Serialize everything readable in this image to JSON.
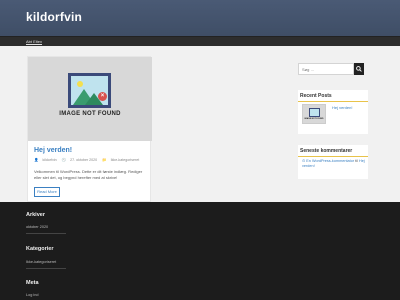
{
  "header": {
    "site_title": "kildorfvin"
  },
  "nav": {
    "items": [
      "Abt Eltex"
    ]
  },
  "post": {
    "thumbnail_text": "IMAGE NOT FOUND",
    "title": "Hej verden!",
    "author": "kildorfvin",
    "date": "27. oktober 2020",
    "category": "Ikke-kategoriseret",
    "excerpt": "Velkommen til WordPress. Dette er dit første indlæg. Rediger eller slet det, og begynd herefter med at skrive!",
    "read_more": "Read More"
  },
  "sidebar": {
    "search": {
      "placeholder": "Søg …",
      "button_icon": "search-icon"
    },
    "recent_posts": {
      "title": "Recent Posts",
      "items": [
        {
          "title": "Hej verden!",
          "thumbnail_text": "IMAGE NOT FOUND"
        }
      ]
    },
    "recent_comments": {
      "title": "Seneste kommentarer",
      "items": [
        {
          "author": "En WordPress-kommentator",
          "connector": "til",
          "post": "Hej verden!"
        }
      ]
    }
  },
  "footer": {
    "archives": {
      "title": "Arkiver",
      "items": [
        "oktober 2020"
      ]
    },
    "categories": {
      "title": "Kategorier",
      "items": [
        "Ikke-kategoriseret"
      ]
    },
    "meta": {
      "title": "Meta",
      "items": [
        "Log ind"
      ]
    }
  },
  "colors": {
    "header_bg": "#44536d",
    "link": "#3b80c2",
    "accent": "#e8c34a",
    "footer_bg": "#1c1c1c"
  }
}
